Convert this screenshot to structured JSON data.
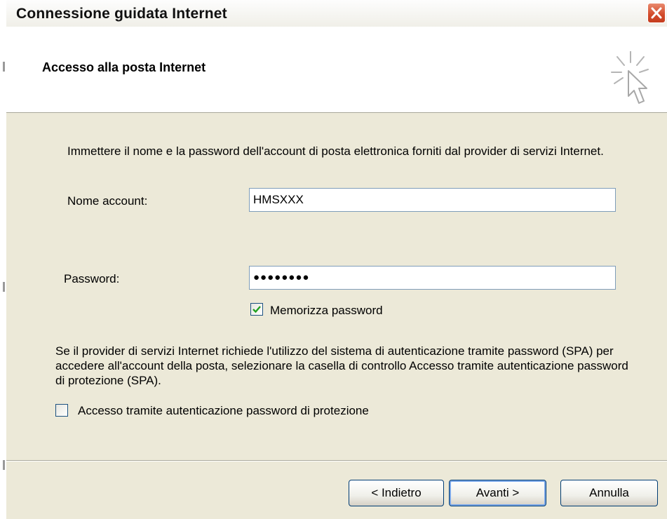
{
  "window": {
    "title": "Connessione guidata Internet",
    "close_icon": "close-icon"
  },
  "header": {
    "title": "Accesso alla posta Internet",
    "icon": "wizard-cursor-icon"
  },
  "form": {
    "intro": "Immettere il nome e la password dell'account di posta elettronica forniti dal provider di servizi Internet.",
    "account_label": "Nome account:",
    "account_value": "HMSXXX",
    "password_label": "Password:",
    "password_value": "●●●●●●●●",
    "remember_label": "Memorizza password",
    "remember_checked": true,
    "spa_info": "Se il provider di servizi Internet richiede l'utilizzo del sistema di autenticazione tramite password (SPA) per accedere all'account della posta, selezionare la casella di controllo Accesso tramite autenticazione password di protezione (SPA).",
    "spa_label": "Accesso tramite autenticazione password di protezione",
    "spa_checked": false
  },
  "buttons": {
    "back": "< Indietro",
    "next": "Avanti >",
    "cancel": "Annulla"
  },
  "colors": {
    "dialog_bg": "#ece9d8",
    "checkmark": "#21a121",
    "close_button": "#d24a2a",
    "focus_border": "#7aa7e8"
  }
}
